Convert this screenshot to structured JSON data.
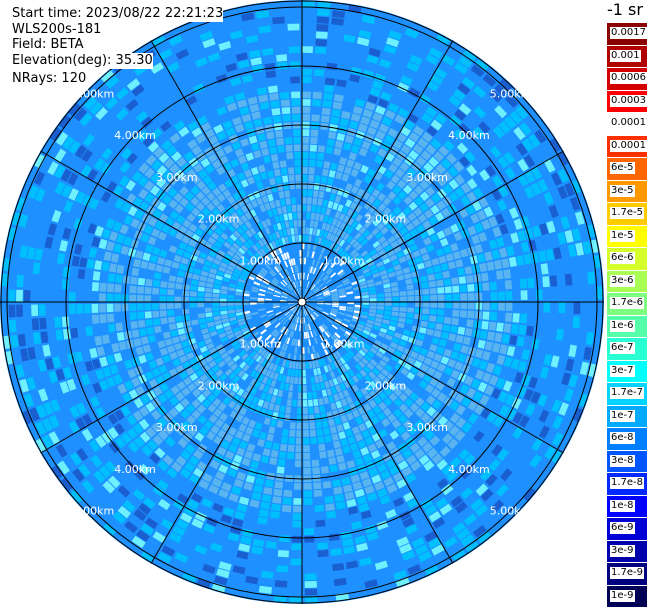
{
  "info": {
    "start_time": "Start time: 2023/08/22 22:21:23",
    "instrument": "WLS200s-181",
    "field": "Field: BETA",
    "elevation": "Elevation(deg): 35.30",
    "nrays": "NRays: 120"
  },
  "colorbar": {
    "title": "-1 sr",
    "labels": [
      "0.0017",
      "0.001",
      "0.0006",
      "0.0003",
      "0.00017",
      "0.0001",
      "6e-5",
      "3e-5",
      "1.7e-5",
      "1e-5",
      "6e-6",
      "3e-6",
      "1.7e-6",
      "1e-6",
      "6e-7",
      "3e-7",
      "1.7e-7",
      "1e-7",
      "6e-8",
      "3e-8",
      "1.7e-8",
      "1e-8",
      "6e-9",
      "3e-9",
      "1.7e-9",
      "1e-9"
    ],
    "colors": [
      "#8b0000",
      "#b00000",
      "#d40000",
      "#ff0000",
      "#ffffff",
      "#ff3000",
      "#ff6600",
      "#ff9900",
      "#ffcc00",
      "#ffff00",
      "#d4ff2a",
      "#aaff55",
      "#7fff7f",
      "#55ffaa",
      "#2affd4",
      "#00ffff",
      "#00d4ff",
      "#00aaff",
      "#007fff",
      "#0055ff",
      "#002aff",
      "#0000ff",
      "#0000d4",
      "#0000aa",
      "#00007f",
      "#000055"
    ]
  },
  "chart_data": {
    "type": "polar-ppi",
    "rays": 120,
    "range_rings_km": [
      1,
      2,
      3,
      4,
      5
    ],
    "ring_labels": [
      "1.00km",
      "2.00km",
      "3.00km",
      "4.00km",
      "5.00km"
    ],
    "azimuth_lines_deg": [
      0,
      30,
      60,
      90,
      120,
      150,
      180,
      210,
      240,
      270,
      300,
      330
    ],
    "max_range_km": 5.1,
    "colors": {
      "dominant": "#1e90ff",
      "secondary": "#00bfff",
      "near_field": "#5ab4f0",
      "highlight": "#6ef0ff",
      "dark": "#1a5fd0"
    }
  }
}
